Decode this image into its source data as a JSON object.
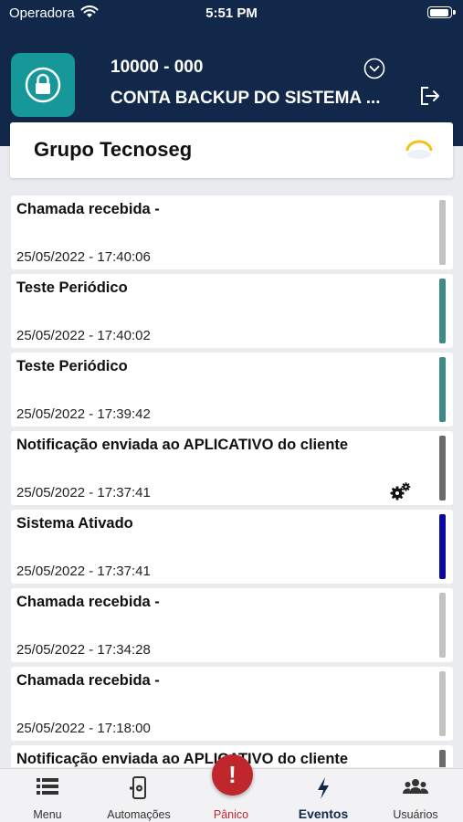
{
  "status": {
    "carrier": "Operadora",
    "time": "5:51 PM"
  },
  "account": {
    "code": "10000 - 000",
    "name": "CONTA BACKUP DO SISTEMA ..."
  },
  "group": {
    "name": "Grupo Tecnoseg"
  },
  "events": [
    {
      "title": "Chamada recebida  -",
      "timestamp": "25/05/2022 - 17:40:06",
      "color": "#c2c2c2"
    },
    {
      "title": "Teste Periódico",
      "timestamp": "25/05/2022 - 17:40:02",
      "color": "#3f8a86"
    },
    {
      "title": "Teste Periódico",
      "timestamp": "25/05/2022 - 17:39:42",
      "color": "#3f8a86"
    },
    {
      "title": "Notificação enviada ao APLICATIVO do cliente",
      "timestamp": "25/05/2022 - 17:37:41",
      "color": "#6b6b6b",
      "icon": "gears-icon"
    },
    {
      "title": "Sistema Ativado",
      "timestamp": "25/05/2022 - 17:37:41",
      "color": "#0a0aa0"
    },
    {
      "title": "Chamada recebida  -",
      "timestamp": "25/05/2022 - 17:34:28",
      "color": "#c2c2c2"
    },
    {
      "title": "Chamada recebida  -",
      "timestamp": "25/05/2022 - 17:18:00",
      "color": "#c2c2c2"
    },
    {
      "title": "Notificação enviada ao APLICATIVO do cliente",
      "timestamp": "",
      "color": "#6b6b6b"
    }
  ],
  "nav": {
    "menu": "Menu",
    "automacoes": "Automações",
    "panico": "Pânico",
    "eventos": "Eventos",
    "usuarios": "Usuários",
    "panic_glyph": "!"
  },
  "colors": {
    "header": "#12284a",
    "accent": "#16979a",
    "panic": "#c0272d"
  }
}
